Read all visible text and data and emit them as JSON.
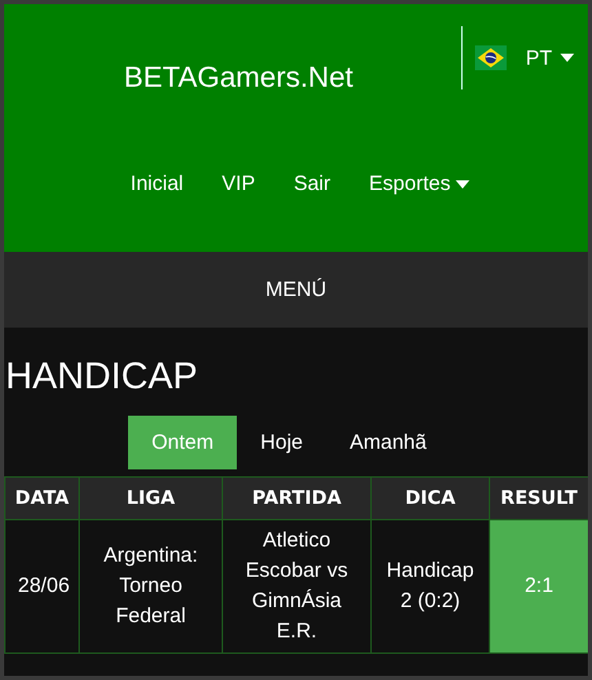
{
  "header": {
    "brand": "BETAGamers.Net",
    "language": {
      "label": "PT"
    },
    "nav": [
      {
        "label": "Inicial",
        "dropdown": false
      },
      {
        "label": "VIP",
        "dropdown": false
      },
      {
        "label": "Sair",
        "dropdown": false
      },
      {
        "label": "Esportes",
        "dropdown": true
      }
    ]
  },
  "menu_bar": {
    "label": "MENÚ"
  },
  "section": {
    "title": "HANDICAP",
    "tabs": [
      {
        "label": "Ontem",
        "selected": true
      },
      {
        "label": "Hoje",
        "selected": false
      },
      {
        "label": "Amanhã",
        "selected": false
      }
    ]
  },
  "table": {
    "columns": [
      "DATA",
      "LIGA",
      "PARTIDA",
      "DICA",
      "RESULT"
    ],
    "rows": [
      {
        "cells": [
          "28/06",
          "Argentina: Torneo Federal",
          "Atletico Escobar vs GimnÁsia E.R.",
          "Handicap 2 (0:2)",
          "2:1"
        ],
        "won": true
      }
    ]
  }
}
